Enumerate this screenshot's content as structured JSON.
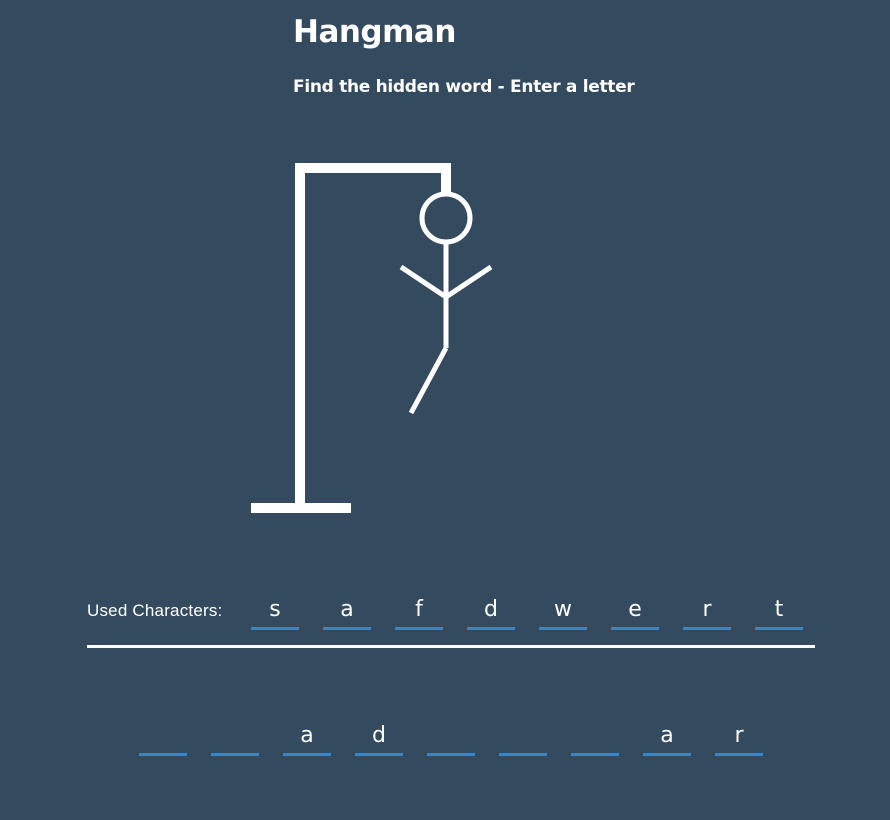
{
  "header": {
    "title": "Hangman",
    "subtitle": "Find the hidden word - Enter a letter"
  },
  "colors": {
    "background": "#344a5f",
    "foreground": "#ffffff",
    "slot_underline": "#3a85c4"
  },
  "drawing": {
    "parts_shown": [
      "base",
      "post",
      "beam",
      "rope",
      "head",
      "body",
      "left-arm",
      "right-arm",
      "left-leg"
    ],
    "wrong_guesses": 9
  },
  "used_characters": {
    "label": "Used Characters:",
    "letters": [
      "s",
      "a",
      "f",
      "d",
      "w",
      "e",
      "r",
      "t"
    ]
  },
  "word": {
    "slots": [
      "",
      "",
      "a",
      "d",
      "",
      "",
      "",
      "a",
      "r"
    ]
  }
}
